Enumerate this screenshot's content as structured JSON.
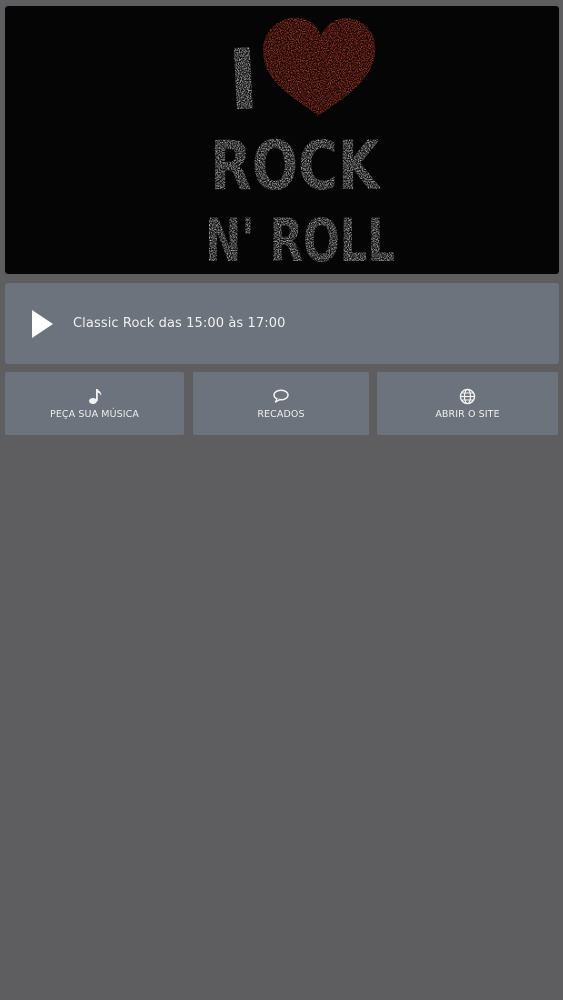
{
  "banner": {
    "line1_letter": "I",
    "line2": "ROCK",
    "line3": "N' ROLL",
    "heart_color": "#e8442c"
  },
  "player": {
    "play_icon": "play-icon",
    "now_playing": "Classic Rock das 15:00 às 17:00"
  },
  "actions": [
    {
      "icon": "music-note-icon",
      "label": "PEÇA SUA MÚSICA"
    },
    {
      "icon": "chat-bubble-icon",
      "label": "RECADOS"
    },
    {
      "icon": "globe-icon",
      "label": "ABRIR O SITE"
    }
  ],
  "colors": {
    "background": "#5e5d60",
    "panel": "#6c737c",
    "banner_bg": "#050505",
    "text": "#f1f1f1"
  }
}
